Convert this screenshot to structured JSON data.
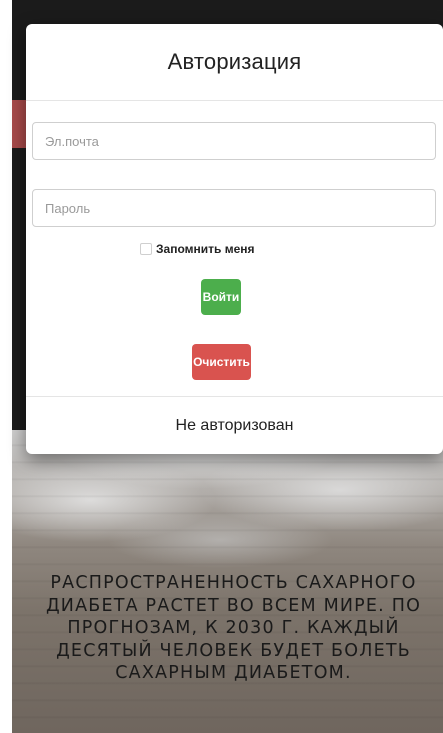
{
  "modal": {
    "title": "Авторизация",
    "email_placeholder": "Эл.почта",
    "email_value": "",
    "password_placeholder": "Пароль",
    "password_value": "",
    "remember_label": "Запомнить меня",
    "login_label": "Войти",
    "clear_label": "Очистить",
    "status": "Не авторизован"
  },
  "hero": {
    "lines": [
      "РАСПРОСТРАНЕННОСТЬ САХАРНОГО",
      "ДИАБЕТА РАСТЕТ ВО ВСЕМ МИРЕ. ПО",
      "ПРОГНОЗАМ, К 2030 Г. КАЖДЫЙ",
      "ДЕСЯТЫЙ ЧЕЛОВЕК БУДЕТ БОЛЕТЬ",
      "САХАРНЫМ ДИАБЕТОМ."
    ]
  },
  "colors": {
    "login_button": "#4cae4c",
    "clear_button": "#d9534f",
    "accent_strip": "#a84a4a",
    "page_background": "#1b1b1b"
  }
}
